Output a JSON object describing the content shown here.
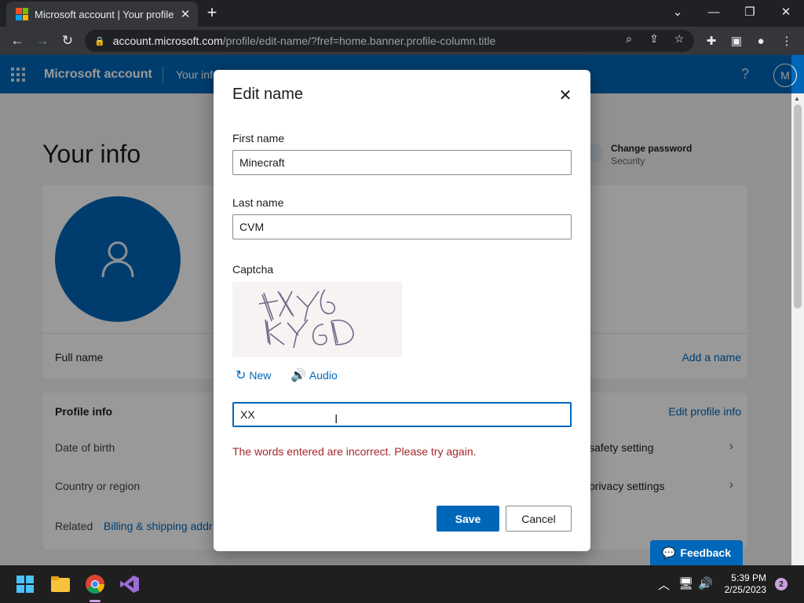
{
  "browser": {
    "tab_title": "Microsoft account | Your profile",
    "url_host": "account.microsoft.com",
    "url_path": "/profile/edit-name/?fref=home.banner.profile-column.title"
  },
  "header": {
    "brand": "Microsoft account",
    "nav_item": "Your info",
    "help": "?",
    "avatar_initial": "M"
  },
  "page": {
    "heading": "Your info",
    "change_password": "Change password",
    "change_password_sub": "Security",
    "full_name_label": "Full name",
    "add_name_link": "Add a name",
    "profile_info_label": "Profile info",
    "edit_profile_link": "Edit profile info",
    "date_of_birth": "Date of birth",
    "country_region": "Country or region",
    "related": "Related",
    "billing_link": "Billing & shipping addr",
    "safety_setting": "safety setting",
    "privacy_settings": "privacy settings",
    "feedback": "Feedback"
  },
  "dialog": {
    "title": "Edit name",
    "first_name_label": "First name",
    "first_name_value": "Minecraft",
    "last_name_label": "Last name",
    "last_name_value": "CVM",
    "captcha_label": "Captcha",
    "new_label": "New",
    "audio_label": "Audio",
    "captcha_value": "XX",
    "error": "The words entered are incorrect. Please try again.",
    "save": "Save",
    "cancel": "Cancel"
  },
  "taskbar": {
    "time": "5:39 PM",
    "date": "2/25/2023",
    "notifications": "2"
  },
  "colors": {
    "accent": "#0067b8",
    "error": "#a4262c"
  }
}
